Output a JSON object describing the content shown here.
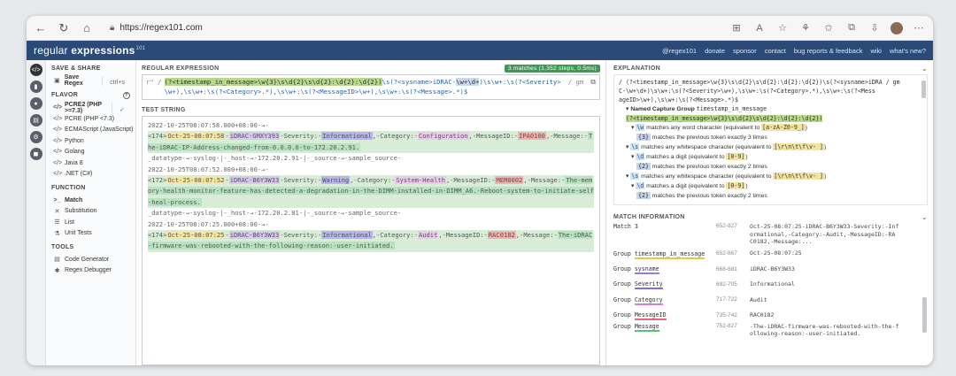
{
  "browser": {
    "url": "https://regex101.com"
  },
  "header": {
    "logo_a": "regular",
    "logo_b": " expressions",
    "logo_sup": "101",
    "links": [
      "@regex101",
      "donate",
      "sponsor",
      "contact",
      "bug reports & feedback",
      "wiki",
      "what's new?"
    ]
  },
  "sidebar": {
    "save_share": "SAVE & SHARE",
    "save_regex": "Save Regex",
    "save_shortcut": "ctrl+s",
    "flavor": "FLAVOR",
    "flavors": [
      "PCRE2 (PHP >=7.3)",
      "PCRE (PHP <7.3)",
      "ECMAScript (JavaScript)",
      "Python",
      "Golang",
      "Java 8",
      ".NET (C#)"
    ],
    "function": "FUNCTION",
    "functions": [
      "Match",
      "Substitution",
      "List",
      "Unit Tests"
    ],
    "tools": "TOOLS",
    "tool_items": [
      "Code Generator",
      "Regex Debugger"
    ]
  },
  "regex": {
    "label": "REGULAR EXPRESSION",
    "badge": "3 matches (1,352 steps, 0.5ms)",
    "delim": "r\" /",
    "flags": "/ gm",
    "p1": "(?<timestamp_in_message>\\w{3}\\s\\d{2}\\s\\d{2}:\\d{2}:\\d{2})",
    "p2": "\\s(?<sysname>iDRAC-",
    "p3": "\\w+\\d+",
    "p4": ")\\s\\w+:\\s(?<Severity>\\w+),\\s\\w+:\\s(?<Category>.*),\\s\\w+:\\s(?<MessageID>\\w+),\\s\\w+:\\s(?<Message>.*)$"
  },
  "test": {
    "label": "TEST STRING",
    "lines": [
      {
        "kind": "plain",
        "text": "2022-10-25T08:07:58.000+08:00-→-"
      },
      {
        "kind": "match",
        "pre": "<174>",
        "ts": "Oct-25-08:07:58",
        "a": "-",
        "sys": "iDRAC-GMXY393",
        "b": "-Severity:-",
        "sev": "Informational",
        "c": ",-Category:-",
        "cat": "Configuration",
        "d": ",-MessageID:-",
        "id": "IPA0100",
        "e": ",-Message:-",
        "msg": "The-iDRAC-IP-Address-changed-from-0.0.0.0-to-172.20.2.91."
      },
      {
        "kind": "plain",
        "text": "_datatype-→-syslog-|-_host-→-172.20.2.91-|-_source-→-sample_source-"
      },
      {
        "kind": "plain",
        "text": "2022-10-25T08:07:52.000+08:00-→-"
      },
      {
        "kind": "match",
        "pre": "<172>",
        "ts": "Oct-25-08:07:52",
        "a": "-",
        "sys": "iDRAC-B6Y3W33",
        "b": "-Severity:-",
        "sev": "Warning",
        "c": ",-Category:-",
        "cat": "System-Health",
        "d": ",-MessageID:-",
        "id": "MEM8002",
        "e": ",-Message:-",
        "msg": "The-memory-health-monitor-feature-has-detected-a-degradation-in-the-DIMM-installed-in-DIMM_A6.-Reboot-system-to-initiate-self-heal-process."
      },
      {
        "kind": "plain",
        "text": "_datatype-→-syslog-|-_host-→-172.20.2.81-|-_source-→-sample_source-"
      },
      {
        "kind": "plain",
        "text": "2022-10-25T08:07:25.000+08:00-→-"
      },
      {
        "kind": "match",
        "pre": "<174>",
        "ts": "Oct-25-08:07:25",
        "a": "-",
        "sys": "iDRAC-B6Y3W33",
        "b": "-Severity:-",
        "sev": "Informational",
        "c": ",-Category:-",
        "cat": "Audit",
        "d": ",-MessageID:-",
        "id": "RAC0182",
        "e": ",-Message:-",
        "msg": "The-iDRAC-firmware-was-rebooted-with-the-following-reason:-user-initiated."
      }
    ]
  },
  "explanation": {
    "label": "EXPLANATION",
    "regex_line": "/ (?<timestamp_in_message>\\w{3}\\s\\d{2}\\s\\d{2}:\\d{2}:\\d{2})\\s(?<sysname>iDRA / gm",
    "regex_line2": "C-\\w+\\d+)\\s\\w+:\\s(?<Severity>\\w+),\\s\\w+:\\s(?<Category>.*),\\s\\w+:\\s(?<Mess",
    "regex_line3": "ageID>\\w+),\\s\\w+:\\s(?<Message>.*)$",
    "group_title": "Named Capture Group",
    "group_name": "timestamp_in_message",
    "group_expr": "(?<timestamp_in_message>\\w{3}\\s\\d{2}\\s\\d{2}:\\d{2}:\\d{2})",
    "items": [
      {
        "level": 2,
        "tok": "\\w",
        "text": " matches any word character (equivalent to ",
        "q": "[a-zA-Z0-9_]",
        "tail": ")"
      },
      {
        "level": 3,
        "tok": "{3}",
        "text": " matches the previous token exactly 3 times",
        "q": "",
        "tail": ""
      },
      {
        "level": 1,
        "tok": "\\s",
        "text": " matches any whitespace character (equivalent to ",
        "q": "[\\r\\n\\t\\f\\v- ]",
        "tail": ")"
      },
      {
        "level": 2,
        "tok": "\\d",
        "text": " matches a digit (equivalent to ",
        "q": "[0-9]",
        "tail": ")"
      },
      {
        "level": 3,
        "tok": "{2}",
        "text": " matches the previous token exactly 2 times",
        "q": "",
        "tail": ""
      },
      {
        "level": 1,
        "tok": "\\s",
        "text": " matches any whitespace character (equivalent to ",
        "q": "[\\r\\n\\t\\f\\v- ]",
        "tail": ")"
      },
      {
        "level": 2,
        "tok": "\\d",
        "text": " matches a digit (equivalent to ",
        "q": "[0-9]",
        "tail": ")"
      },
      {
        "level": 3,
        "tok": "{2}",
        "text": " matches the previous token exactly 2 times",
        "q": "",
        "tail": ""
      }
    ]
  },
  "match_info": {
    "label": "MATCH INFORMATION",
    "partial": {
      "group": "Match 3",
      "range": "652-827",
      "value": "Oct-25-08:07:25-iDRAC-B6Y3W33-Severity:-Inf"
    },
    "partial_line2": "ormational,-Category:-Audit,-MessageID:-RA",
    "partial_line3": "C0182,-Message:...",
    "rows": [
      {
        "group": "timestamp_in_message",
        "range": "652-667",
        "value": "Oct-25-08:07:25",
        "color": "#e2c94a"
      },
      {
        "group": "sysname",
        "range": "668-681",
        "value": "iDRAC-B6Y3W33",
        "color": "#9b7bd8"
      },
      {
        "group": "Severity",
        "range": "692-705",
        "value": "Informational",
        "color": "#7a72e0"
      },
      {
        "group": "Category",
        "range": "717-722",
        "value": "Audit",
        "color": "#d87ad8"
      },
      {
        "group": "MessageID",
        "range": "735-742",
        "value": "RAC0182",
        "color": "#e06b6b"
      },
      {
        "group": "Message",
        "range": "752-827",
        "value": "-The-iDRAC-firmware-was-rebooted-with-the-f",
        "value2": "ollowing-reason:-user-initiated.",
        "color": "#5cbf74"
      }
    ]
  },
  "colors": {
    "header_bg": "#2b4a78",
    "match_bg": "#d8ecd8",
    "badge_bg": "#3e9a53"
  }
}
